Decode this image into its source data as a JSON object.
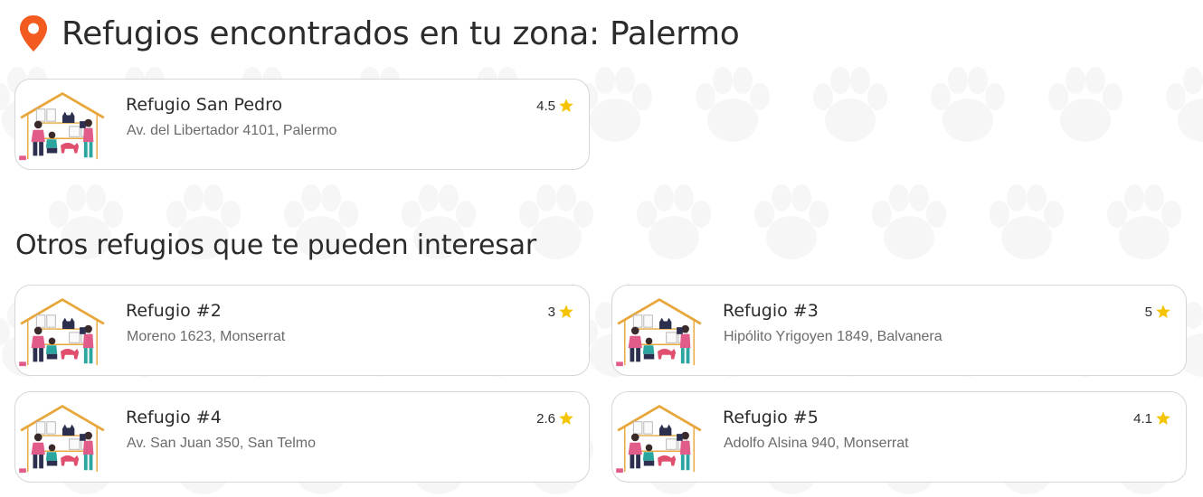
{
  "header": {
    "title": "Refugios encontrados en tu zona: Palermo",
    "location_icon": "map-pin-icon",
    "pin_color": "#f25a1f"
  },
  "local_shelters": [
    {
      "name": "Refugio San Pedro",
      "address": "Av. del Libertador 4101, Palermo",
      "rating": "4.5"
    }
  ],
  "other_section": {
    "title": "Otros refugios que te pueden interesar"
  },
  "other_shelters": [
    {
      "name": "Refugio #2",
      "address": "Moreno 1623, Monserrat",
      "rating": "3"
    },
    {
      "name": "Refugio #3",
      "address": "Hipólito Yrigoyen 1849, Balvanera",
      "rating": "5"
    },
    {
      "name": "Refugio #4",
      "address": "Av. San Juan 350, San Telmo",
      "rating": "2.6"
    },
    {
      "name": "Refugio #5",
      "address": "Adolfo Alsina 940, Monserrat",
      "rating": "4.1"
    }
  ],
  "icons": {
    "rating": "star-icon",
    "thumbnail": "shelter-illustration",
    "background": "paw-print-pattern"
  },
  "colors": {
    "star": "#f5c400",
    "accent": "#f25a1f",
    "paw": "#f6f6f6"
  }
}
